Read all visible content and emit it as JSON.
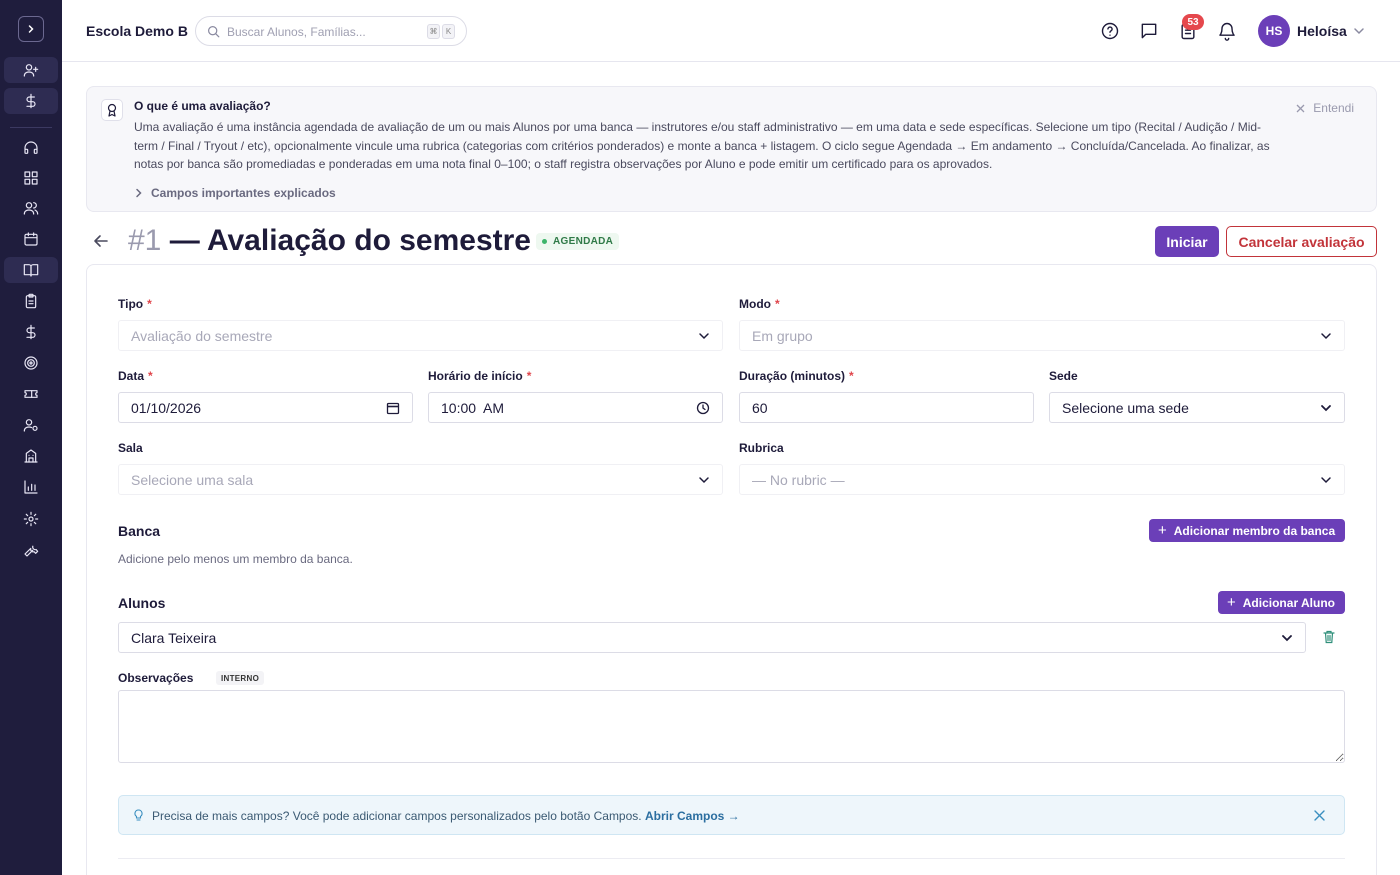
{
  "colors": {
    "sidebar_bg": "#1f1d3d",
    "accent": "#6b3fb8",
    "danger": "#c2343a",
    "status_green": "#2f7a47",
    "notification_red": "#e5484d"
  },
  "sidebar": {
    "items": [
      "user-plus-icon",
      "dollar-icon",
      "headset-icon",
      "grid-icon",
      "users-icon",
      "calendar-icon",
      "book-open-icon",
      "clipboard-icon",
      "dollar-icon",
      "target-icon",
      "ticket-icon",
      "user-gear-icon",
      "building-icon",
      "bar-chart-icon",
      "settings-icon",
      "wrench-icon"
    ]
  },
  "header": {
    "school_name": "Escola Demo B",
    "search_placeholder": "Buscar Alunos, Famílias...",
    "kbd_modifier": "⌘",
    "kbd_key": "K",
    "notification_count": "53",
    "avatar_initials": "HS",
    "user_name": "Heloísa"
  },
  "info": {
    "title": "O que é uma avaliação?",
    "text": "Uma avaliação é uma instância agendada de avaliação de um ou mais Alunos por uma banca — instrutores e/ou staff administrativo — em uma data e sede específicas. Selecione um tipo (Recital / Audição / Mid-term / Final / Tryout / etc), opcionalmente vincule uma rubrica (categorias com critérios ponderados) e monte a banca + listagem. O ciclo segue Agendada → Em andamento → Concluída/Cancelada. Ao finalizar, as notas por banca são promediadas e ponderadas em uma nota final 0–100; o staff registra observações por Aluno e pode emitir um certificado para os aprovados.",
    "dismiss_label": "Entendi",
    "more_label": "Campos importantes explicados"
  },
  "page": {
    "number": "#1",
    "title": "— Avaliação do semestre",
    "status": "AGENDADA",
    "start_button": "Iniciar",
    "cancel_button": "Cancelar avaliação"
  },
  "form": {
    "tipo": {
      "label": "Tipo",
      "value": "Avaliação do semestre"
    },
    "modo": {
      "label": "Modo",
      "value": "Em grupo"
    },
    "data": {
      "label": "Data",
      "value": "01/10/2026"
    },
    "horario": {
      "label": "Horário de início",
      "value": "10:00  AM"
    },
    "duracao": {
      "label": "Duração (minutos)",
      "value": "60"
    },
    "sede": {
      "label": "Sede",
      "value": "Selecione uma sede"
    },
    "sala": {
      "label": "Sala",
      "value": "Selecione uma sala"
    },
    "rubrica": {
      "label": "Rubrica",
      "value": "— No rubric —"
    },
    "required_mark": "*"
  },
  "banca": {
    "title": "Banca",
    "add_button": "Adicionar membro da banca",
    "hint": "Adicione pelo menos um membro da banca."
  },
  "alunos": {
    "title": "Alunos",
    "add_button": "Adicionar Aluno",
    "selected": "Clara Teixeira"
  },
  "observacoes": {
    "label": "Observações",
    "tag": "INTERNO",
    "value": ""
  },
  "tip": {
    "text": "Precisa de mais campos? Você pode adicionar campos personalizados pelo botão Campos.",
    "link": "Abrir Campos →"
  }
}
